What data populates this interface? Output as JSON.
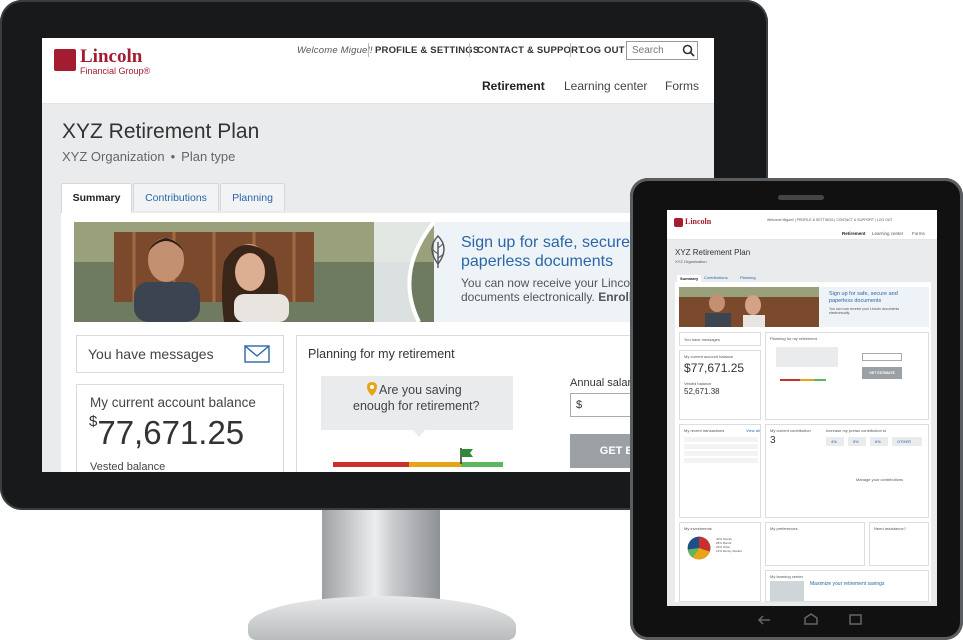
{
  "site": {
    "logo_main": "Lincoln",
    "logo_sub": "Financial Group®",
    "welcome": "Welcome Miguel!",
    "profile": "PROFILE & SETTINGS",
    "contact": "CONTACT & SUPPORT",
    "logout": "LOG OUT",
    "search_placeholder": "Search",
    "nav": [
      "Retirement",
      "Learning center",
      "Forms"
    ]
  },
  "plan": {
    "title": "XYZ Retirement Plan",
    "org": "XYZ Organization",
    "type": "Plan type"
  },
  "tabs": [
    "Summary",
    "Contributions",
    "Planning"
  ],
  "banner": {
    "headline1": "Sign up for safe, secure",
    "headline2": "paperless documents",
    "body1": "You can now receive your Lincoln",
    "body2": "documents electronically.",
    "enroll": "Enroll"
  },
  "messages": {
    "label": "You have messages"
  },
  "balance": {
    "label": "My current account balance",
    "currency": "$",
    "value": "77,671.25",
    "vested_label": "Vested balance",
    "vested_value": "52,671.38"
  },
  "planning": {
    "title": "Planning for my retirement",
    "question1": "Are you saving",
    "question2": "enough for retirement?",
    "salary_label": "Annual salary",
    "salary_prefix": "$",
    "estimate_btn": "GET ESTIMATE"
  },
  "tablet": {
    "tabs": [
      "Summary",
      "Contributions",
      "Planning"
    ],
    "headline1": "Sign up for safe, secure and",
    "headline2": "paperless documents",
    "body": "You can now receive your Lincoln documents electronically.",
    "enroll": "Enroll today",
    "vested_value": "52,671.38",
    "transactions_title": "My recent transactions",
    "view_all": "View all",
    "contribution_title": "My current contribution",
    "contribution_value": "3",
    "increase_title": "Increase my pretax contribution to",
    "increase_opts": [
      "4%",
      "5%",
      "6%",
      "OTHER"
    ],
    "manage": "Manage your contributions",
    "preferences_title": "My preferences",
    "assistance_title": "Need assistance?",
    "investments_title": "My investments",
    "learning_title": "My learning center",
    "learning_headline": "Maximize your retirement savings",
    "estimate_btn": "GET ESTIMATE",
    "pie_legend": [
      "40% Stocks",
      "28% Bonds",
      "20% Other",
      "12% Money Market"
    ]
  },
  "colors": {
    "brand": "#a51c30",
    "link": "#2a66a8",
    "meter": [
      "#c9302c",
      "#e8a317",
      "#5cb85c"
    ]
  }
}
